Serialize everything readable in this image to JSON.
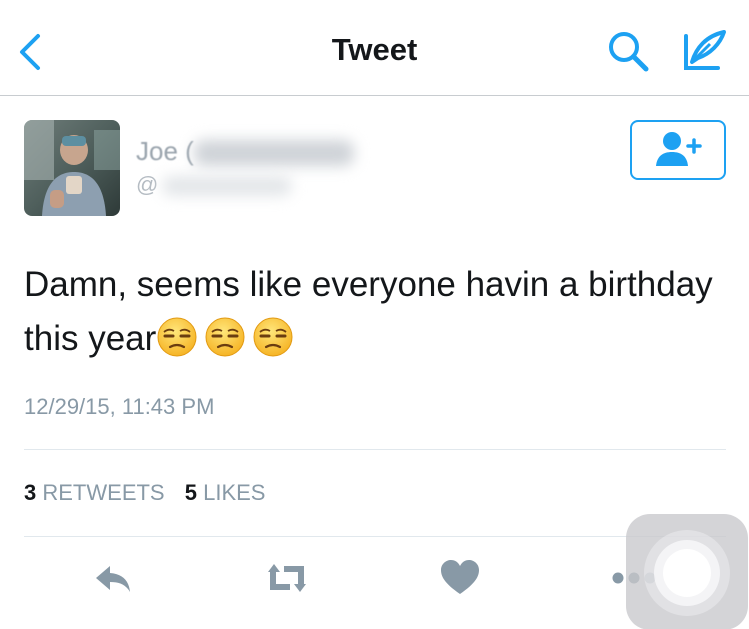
{
  "header": {
    "title": "Tweet",
    "back_icon": "chevron-left-icon",
    "search_icon": "search-icon",
    "compose_icon": "compose-icon",
    "accent_color": "#1da1f2"
  },
  "tweet": {
    "author_name": "Joe (",
    "author_handle": "@",
    "follow_icon": "add-user-icon",
    "text": "Damn, seems like everyone havin a birthday this year",
    "emojis": [
      "unamused-face-icon",
      "unamused-face-icon",
      "unamused-face-icon"
    ],
    "timestamp": "12/29/15, 11:43 PM"
  },
  "stats": {
    "retweets_count": "3",
    "retweets_label": "RETWEETS",
    "likes_count": "5",
    "likes_label": "LIKES"
  },
  "actions": {
    "icons": [
      "reply-icon",
      "retweet-icon",
      "heart-icon",
      "more-icon"
    ],
    "icon_color": "#8899a6"
  }
}
